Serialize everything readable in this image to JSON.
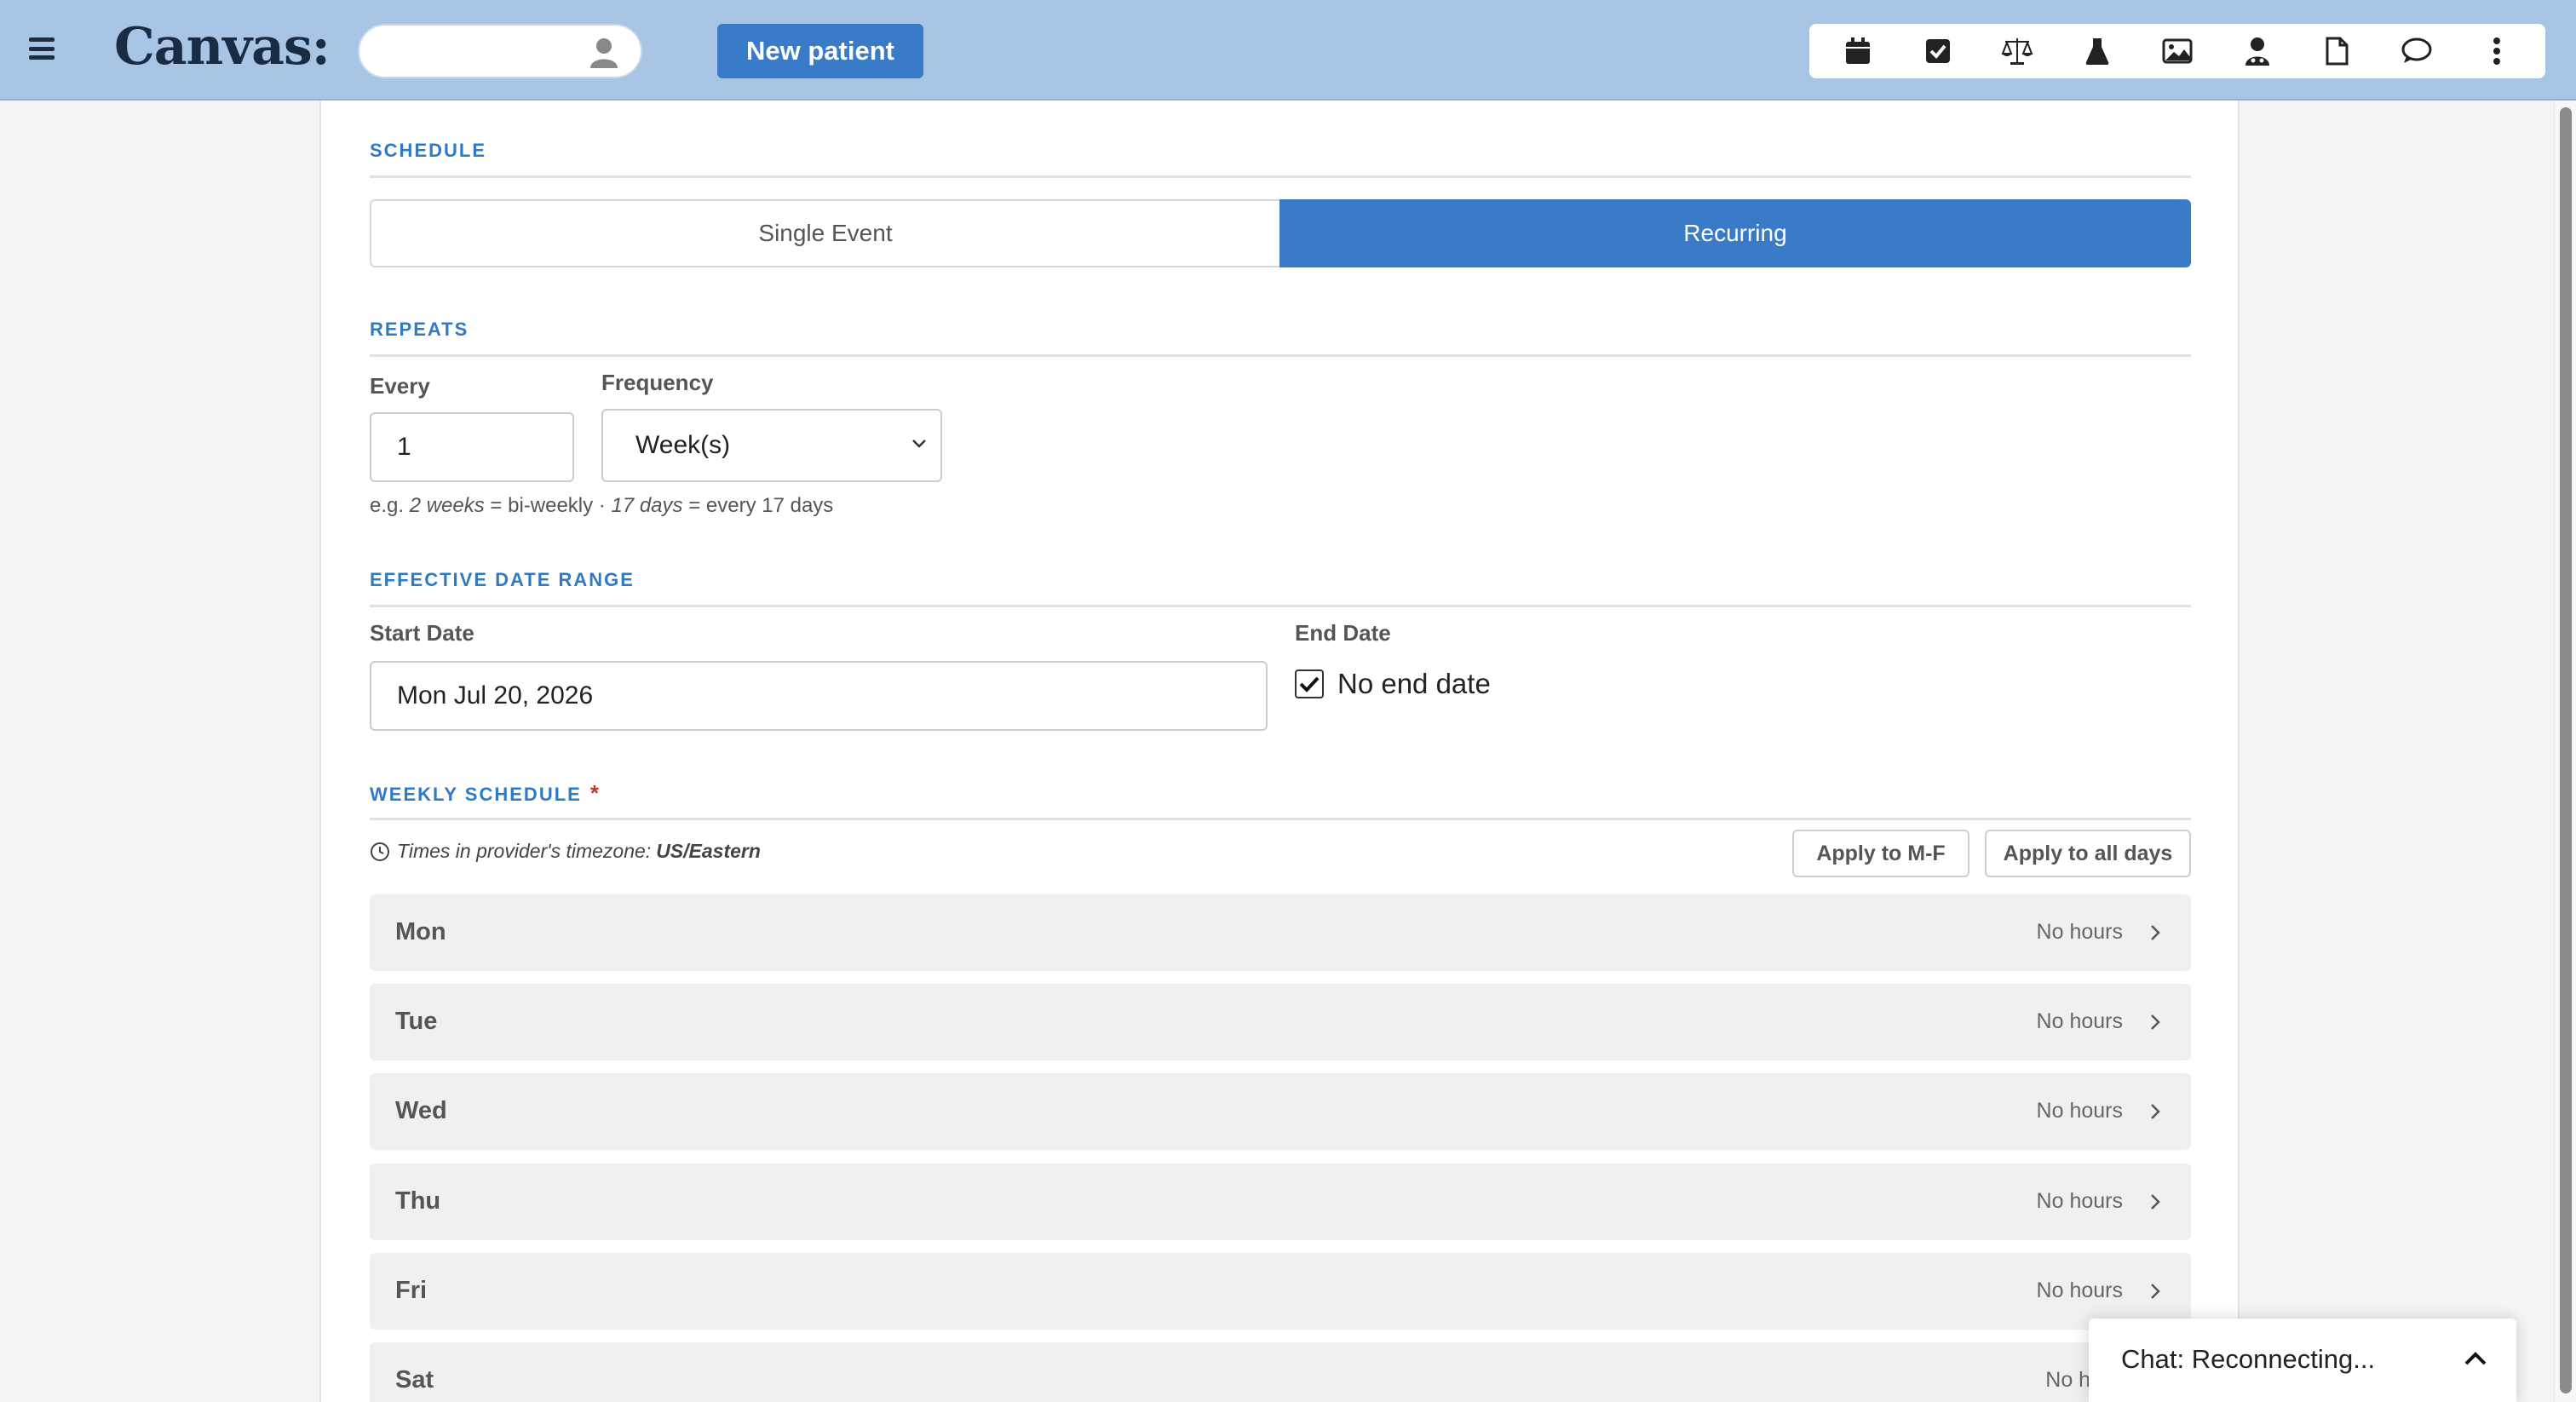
{
  "app": {
    "logo": "Canvas:",
    "new_patient_label": "New patient",
    "toolbar_icons": [
      "calendar-icon",
      "checkbox-icon",
      "scales-icon",
      "flask-icon",
      "image-icon",
      "doctor-icon",
      "document-icon",
      "chat-bubble-icon",
      "more-icon"
    ]
  },
  "schedule": {
    "title": "SCHEDULE",
    "options": [
      "Single Event",
      "Recurring"
    ],
    "selected": "Recurring"
  },
  "repeats": {
    "title": "REPEATS",
    "every_label": "Every",
    "every_value": "1",
    "frequency_label": "Frequency",
    "frequency_value": "Week(s)",
    "hint_prefix": "e.g. ",
    "hint_a": "2 weeks",
    "hint_b": " = bi-weekly · ",
    "hint_c": "17 days",
    "hint_d": " = every 17 days"
  },
  "date_range": {
    "title": "EFFECTIVE DATE RANGE",
    "start_label": "Start Date",
    "start_value": "Mon Jul 20, 2026",
    "end_label": "End Date",
    "no_end_label": "No end date",
    "no_end_checked": true
  },
  "weekly": {
    "title": "WEEKLY SCHEDULE",
    "required_mark": "*",
    "tz_text": "Times in provider's timezone:",
    "tz_value": "US/Eastern",
    "apply_mf": "Apply to M-F",
    "apply_all": "Apply to all days",
    "days": [
      {
        "day": "Mon",
        "hours": "No hours"
      },
      {
        "day": "Tue",
        "hours": "No hours"
      },
      {
        "day": "Wed",
        "hours": "No hours"
      },
      {
        "day": "Thu",
        "hours": "No hours"
      },
      {
        "day": "Fri",
        "hours": "No hours"
      },
      {
        "day": "Sat",
        "hours": "No ho"
      }
    ]
  },
  "chat": {
    "status": "Chat: Reconnecting..."
  },
  "colors": {
    "topbar": "#a8c5e6",
    "accent": "#3a7bc8",
    "section_title": "#2f7ac4"
  }
}
